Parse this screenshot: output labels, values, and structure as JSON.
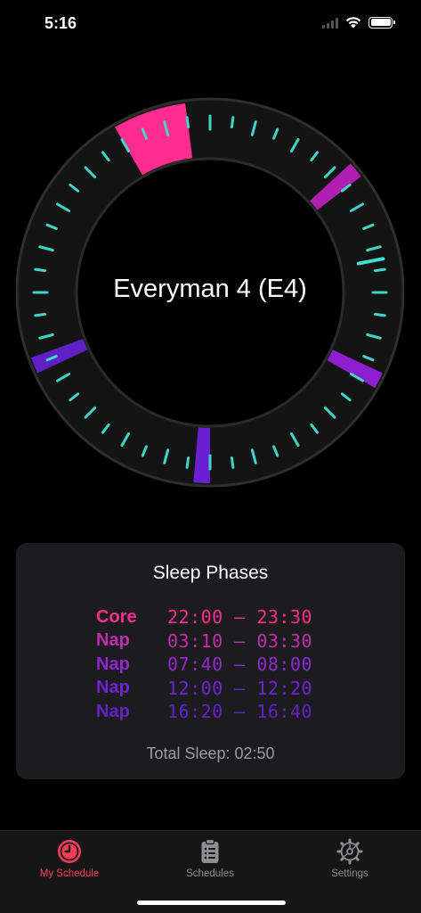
{
  "status_bar": {
    "time": "5:16",
    "icons": [
      "signal-icon",
      "wifi-icon",
      "battery-icon"
    ]
  },
  "clock": {
    "schedule_name": "Everyman 4 (E4)",
    "sleep_blocks": [
      {
        "label": "Core",
        "start": "22:00",
        "end": "23:30",
        "color": "#ff2d8f"
      },
      {
        "label": "Nap",
        "start": "03:10",
        "end": "03:30",
        "color": "#b01fb0"
      },
      {
        "label": "Nap",
        "start": "07:40",
        "end": "08:00",
        "color": "#8c1fcf"
      },
      {
        "label": "Nap",
        "start": "12:00",
        "end": "12:20",
        "color": "#6a1fd0"
      },
      {
        "label": "Nap",
        "start": "16:20",
        "end": "16:40",
        "color": "#5e1fc4"
      }
    ],
    "current_time": "05:16",
    "tick_color": "#40e0d0",
    "ring_color": "#141414"
  },
  "sleep_phases": {
    "title": "Sleep Phases",
    "rows": [
      {
        "label": "Core",
        "time": "22:00 – 23:30",
        "color": "#ff2d8f"
      },
      {
        "label": "Nap",
        "time": "03:10 – 03:30",
        "color": "#c02cb2"
      },
      {
        "label": "Nap",
        "time": "07:40 – 08:00",
        "color": "#9128cf"
      },
      {
        "label": "Nap",
        "time": "12:00 – 12:20",
        "color": "#7024cf"
      },
      {
        "label": "Nap",
        "time": "16:20 – 16:40",
        "color": "#6322c4"
      }
    ],
    "total_sleep": "Total Sleep: 02:50"
  },
  "tab_bar": {
    "tabs": [
      {
        "label": "My Schedule",
        "icon": "clock-icon",
        "active": true
      },
      {
        "label": "Schedules",
        "icon": "clipboard-icon",
        "active": false
      },
      {
        "label": "Settings",
        "icon": "gear-icon",
        "active": false
      }
    ],
    "active_color": "#ff3b5c",
    "inactive_color": "#8e8e93"
  }
}
